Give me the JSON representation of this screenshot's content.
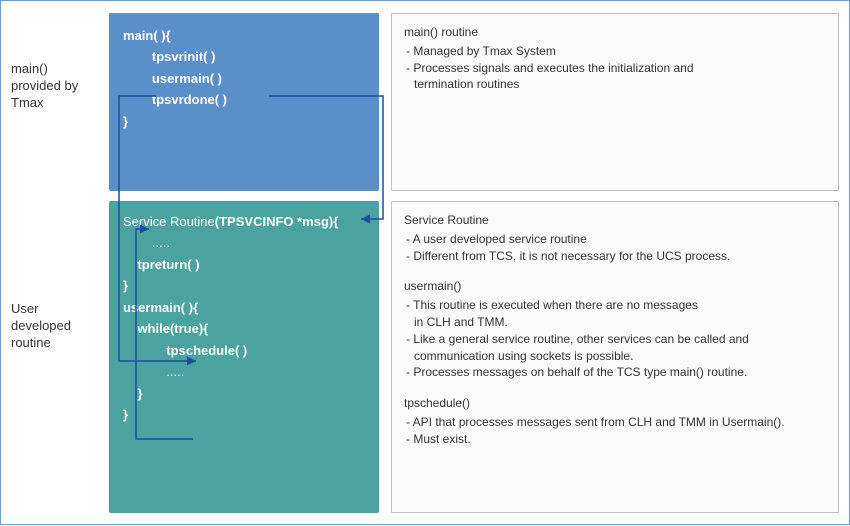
{
  "labels": {
    "top": "main()\nprovided by\nTmax",
    "bottom": "User\ndeveloped\nroutine"
  },
  "code_top": {
    "lines": [
      {
        "t": "main( ){",
        "cls": "bold",
        "pad": 0
      },
      {
        "t": "tpsvrinit( )",
        "cls": "bold",
        "pad": 2
      },
      {
        "t": "",
        "cls": "",
        "pad": 0
      },
      {
        "t": "usermain( )",
        "cls": "bold",
        "pad": 2
      },
      {
        "t": "",
        "cls": "",
        "pad": 0
      },
      {
        "t": "tpsvrdone( )",
        "cls": "bold",
        "pad": 2
      },
      {
        "t": "",
        "cls": "",
        "pad": 0
      },
      {
        "t": "}",
        "cls": "bold",
        "pad": 0
      }
    ]
  },
  "code_bottom": {
    "lines": [
      {
        "t": "Service Routine",
        "cls": "",
        "pad": 0,
        "inline_bold": "(TPSVCINFO *msg){"
      },
      {
        "t": ".....",
        "cls": "",
        "pad": 2
      },
      {
        "t": "",
        "cls": "",
        "pad": 0
      },
      {
        "t": "tpreturn( )",
        "cls": "bold",
        "pad": 1
      },
      {
        "t": "",
        "cls": "",
        "pad": 0
      },
      {
        "t": "}",
        "cls": "bold",
        "pad": 0
      },
      {
        "t": "",
        "cls": "",
        "pad": 0
      },
      {
        "t": "usermain( ){",
        "cls": "bold",
        "pad": 0
      },
      {
        "t": "",
        "cls": "",
        "pad": 0
      },
      {
        "t": "while(true){",
        "cls": "bold",
        "pad": 1
      },
      {
        "t": "",
        "cls": "",
        "pad": 0
      },
      {
        "t": "tpschedule( )",
        "cls": "bold",
        "pad": 3
      },
      {
        "t": "",
        "cls": "",
        "pad": 0
      },
      {
        "t": ".....",
        "cls": "",
        "pad": 3
      },
      {
        "t": "}",
        "cls": "bold",
        "pad": 1
      },
      {
        "t": "}",
        "cls": "bold",
        "pad": 0
      }
    ]
  },
  "desc_top": {
    "blocks": [
      {
        "title": "main() routine",
        "items": [
          "- Managed by Tmax System",
          "- Processes signals and executes the initialization and",
          "  termination routines"
        ]
      }
    ]
  },
  "desc_bottom": {
    "blocks": [
      {
        "title": "Service Routine",
        "items": [
          "- A user developed service routine",
          "- Different from TCS, it is not necessary for the UCS process."
        ]
      },
      {
        "gap": true
      },
      {
        "title": "usermain()",
        "items": [
          "- This routine is executed when there are no messages",
          "  in CLH and TMM.",
          "- Like a general service routine, other services can be called and",
          "  communication using sockets is possible.",
          "- Processes messages on behalf of the TCS type main() routine."
        ]
      },
      {
        "gap": true
      },
      {
        "title": "tpschedule()",
        "items": [
          "- API that processes messages sent from CLH and TMM in Usermain().",
          "- Must exist."
        ]
      }
    ]
  }
}
